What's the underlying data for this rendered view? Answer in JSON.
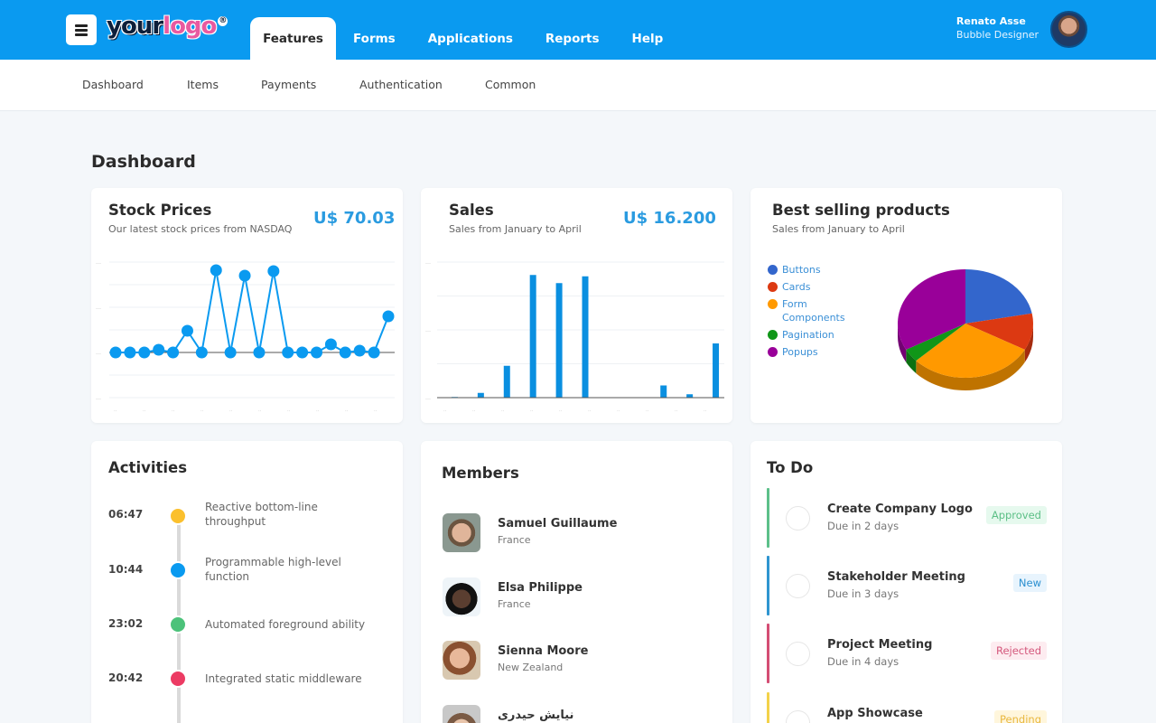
{
  "header": {
    "logo_part1": "your",
    "logo_part2": "logo",
    "logo_mark": "®",
    "menu_icon": "hamburger-icon",
    "nav": [
      {
        "label": "Features",
        "active": true
      },
      {
        "label": "Forms",
        "active": false
      },
      {
        "label": "Applications",
        "active": false
      },
      {
        "label": "Reports",
        "active": false
      },
      {
        "label": "Help",
        "active": false
      }
    ],
    "user": {
      "name": "Renato Asse",
      "role": "Bubble Designer"
    },
    "accent": "#0a9af0"
  },
  "subnav": [
    "Dashboard",
    "Items",
    "Payments",
    "Authentication",
    "Common"
  ],
  "page": {
    "title": "Dashboard"
  },
  "stock": {
    "title": "Stock Prices",
    "subtitle": "Our latest stock prices from NASDAQ",
    "value": "U$ 70.03"
  },
  "sales": {
    "title": "Sales",
    "subtitle": "Sales from January to April",
    "value": "U$ 16.200"
  },
  "best": {
    "title": "Best selling products",
    "subtitle": "Sales from January to April"
  },
  "chart_data": [
    {
      "type": "line",
      "title": "Stock Prices",
      "xlabel": "",
      "ylabel": "",
      "ylim": [
        -1,
        2
      ],
      "grid": true,
      "tick_labels_visible": false,
      "color": "#0a9af0",
      "values": [
        0,
        0,
        0,
        0.06,
        0,
        0.48,
        0,
        1.82,
        0,
        1.7,
        0,
        1.8,
        0,
        0,
        0,
        0.18,
        0,
        0.04,
        0,
        0.8
      ]
    },
    {
      "type": "bar",
      "title": "Sales",
      "xlabel": "",
      "ylabel": "",
      "ylim": [
        0,
        2
      ],
      "grid": true,
      "tick_labels_visible": false,
      "color": "#0a8fe0",
      "values": [
        0.01,
        0.07,
        0.47,
        1.81,
        1.69,
        1.79,
        0,
        0,
        0.18,
        0.05,
        0.8
      ]
    },
    {
      "type": "pie",
      "title": "Best selling products",
      "style": "3d",
      "legend": "left",
      "labels": [
        "Buttons",
        "Cards",
        "Form Components",
        "Pagination",
        "Popups"
      ],
      "values": [
        22,
        11,
        30,
        4,
        33
      ],
      "colors": [
        "#3366cc",
        "#dc3912",
        "#ff9900",
        "#109618",
        "#990099"
      ]
    }
  ],
  "activities": {
    "title": "Activities",
    "items": [
      {
        "time": "06:47",
        "text": "Reactive bottom-line throughput",
        "color": "#fbc02d"
      },
      {
        "time": "10:44",
        "text": "Programmable high-level function",
        "color": "#0a9af0"
      },
      {
        "time": "23:02",
        "text": "Automated foreground ability",
        "color": "#4cc27a"
      },
      {
        "time": "20:42",
        "text": "Integrated static middleware",
        "color": "#ec3b63"
      }
    ]
  },
  "members": {
    "title": "Members",
    "items": [
      {
        "name": "Samuel Guillaume",
        "country": "France"
      },
      {
        "name": "Elsa Philippe",
        "country": "France"
      },
      {
        "name": "Sienna Moore",
        "country": "New Zealand"
      },
      {
        "name": "نیایش حیدری",
        "country": ""
      }
    ]
  },
  "todo": {
    "title": "To Do",
    "items": [
      {
        "title": "Create Company Logo",
        "due": "Due in 2 days",
        "status": "Approved",
        "bar": "#5cc08a",
        "fg": "#5cbf86",
        "bg": "#e6f9ee"
      },
      {
        "title": "Stakeholder Meeting",
        "due": "Due in 3 days",
        "status": "New",
        "bar": "#2f95d0",
        "fg": "#2a8fd0",
        "bg": "#e8f4fd"
      },
      {
        "title": "Project Meeting",
        "due": "Due in 4 days",
        "status": "Rejected",
        "bar": "#d44e74",
        "fg": "#d4587c",
        "bg": "#fdecf0"
      },
      {
        "title": "App Showcase",
        "due": "",
        "status": "Pending",
        "bar": "#f3d24a",
        "fg": "#e9b840",
        "bg": "#fff6dc"
      }
    ]
  }
}
